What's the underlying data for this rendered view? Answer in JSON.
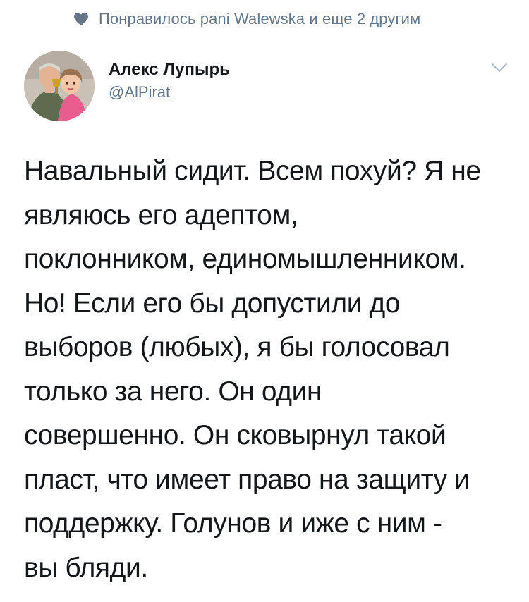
{
  "liked_by": {
    "icon": "heart-icon",
    "text": "Понравилось pani Walewska и еще 2 другим"
  },
  "author": {
    "name": "Алекс Лупырь",
    "handle": "@AlPirat",
    "avatar": "avatar-photo"
  },
  "menu": {
    "icon": "chevron-down-icon"
  },
  "tweet": {
    "lines": [
      "Навальный сидит. Всем похуй? Я не",
      "являюсь его адептом,",
      "поклонником, единомышленником.",
      "Но! Если его бы допустили до",
      "выборов (любых), я бы голосовал",
      "только за него. Он один",
      "совершенно. Он сковырнул такой",
      "пласт, что имеет право на защиту и",
      "поддержку. Голунов и иже с ним -",
      "вы бляди."
    ]
  },
  "colors": {
    "text": "#14171a",
    "secondary": "#657786",
    "chevron": "#aab8c2",
    "heart": "#657786"
  }
}
